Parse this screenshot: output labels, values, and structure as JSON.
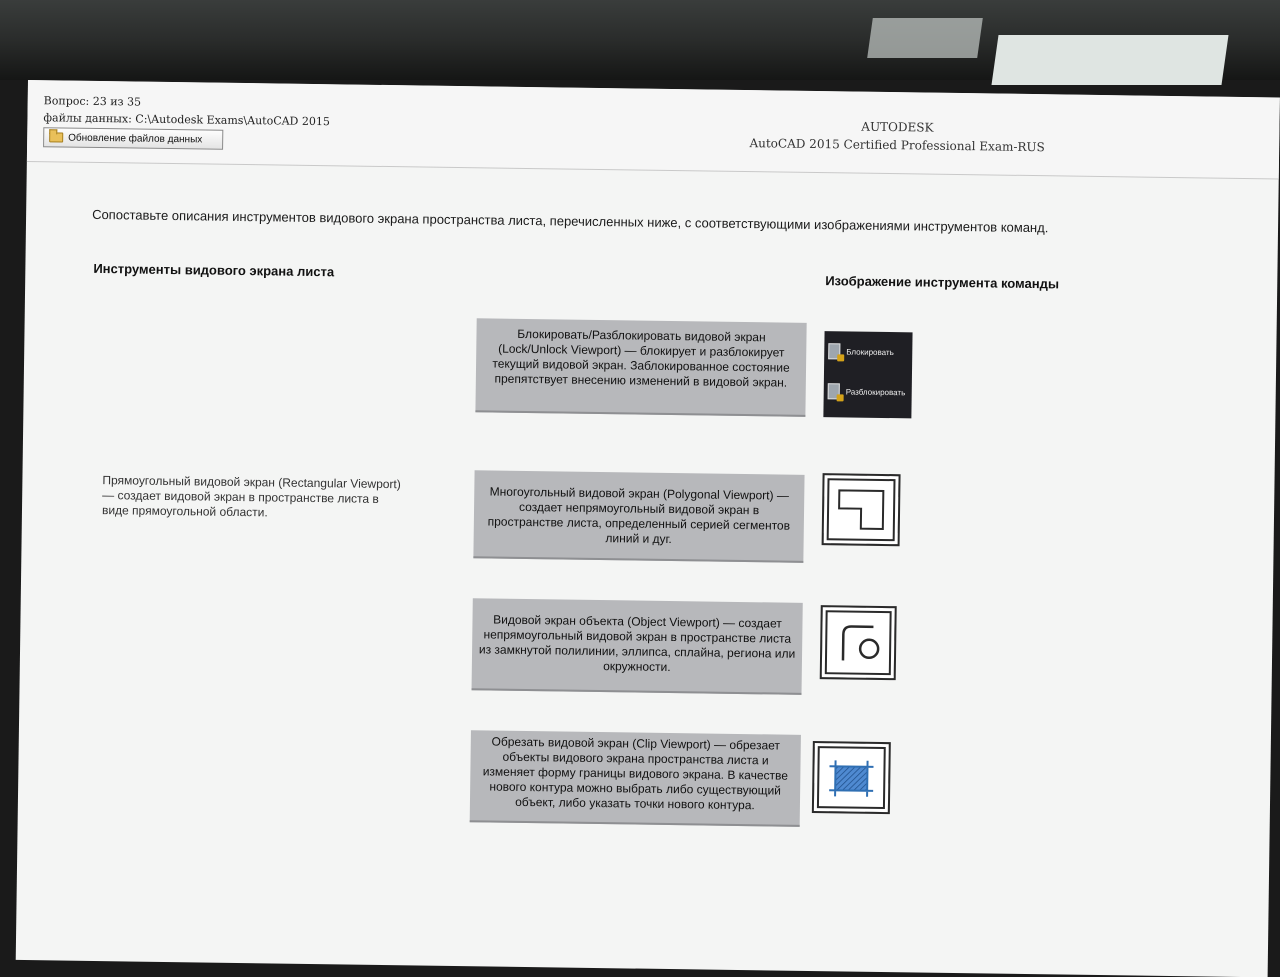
{
  "header": {
    "question": "Вопрос: 23 из 35",
    "files": "файлы данных: C:\\Autodesk Exams\\AutoCAD 2015",
    "update_button": "Обновление файлов данных",
    "brand": "AUTODESK",
    "exam": "AutoCAD 2015 Certified Professional Exam-RUS"
  },
  "task": {
    "instruction": "Сопоставьте описания инструментов видового экрана пространства листа, перечисленных ниже, с соответствующими изображениями инструментов команд.",
    "left_heading": "Инструменты видового экрана листа",
    "right_heading": "Изображение инструмента команды",
    "left_items": [
      "Прямоугольный видовой экран (Rectangular Viewport) — создает видовой экран в пространстве листа в виде прямоугольной области."
    ],
    "descriptions": [
      "Блокировать/Разблокировать видовой экран (Lock/Unlock Viewport) — блокирует и разблокирует текущий видовой экран. Заблокированное состояние препятствует внесению изменений в видовой экран.",
      "Многоугольный видовой экран (Polygonal Viewport) — создает непрямоугольный видовой экран в пространстве листа, определенный серией сегментов линий и дуг.",
      "Видовой экран объекта (Object Viewport) — создает непрямоугольный видовой экран в пространстве листа из замкнутой полилинии, эллипса, сплайна, региона или окружности.",
      "Обрезать видовой экран (Clip Viewport) — обрезает объекты видового экрана пространства листа и изменяет форму границы видового экрана. В качестве нового контура можно выбрать либо существующий объект, либо указать точки нового контура."
    ],
    "lock_panel": {
      "lock_label": "Блокировать",
      "unlock_label": "Разблокировать"
    }
  },
  "icons": [
    "folder-icon",
    "lock-icon",
    "unlock-icon",
    "polygonal-viewport-icon",
    "object-viewport-icon",
    "clip-viewport-icon"
  ],
  "colors": {
    "answer_block": "#b7b8bb",
    "clip_accent": "#2f6fb3"
  }
}
